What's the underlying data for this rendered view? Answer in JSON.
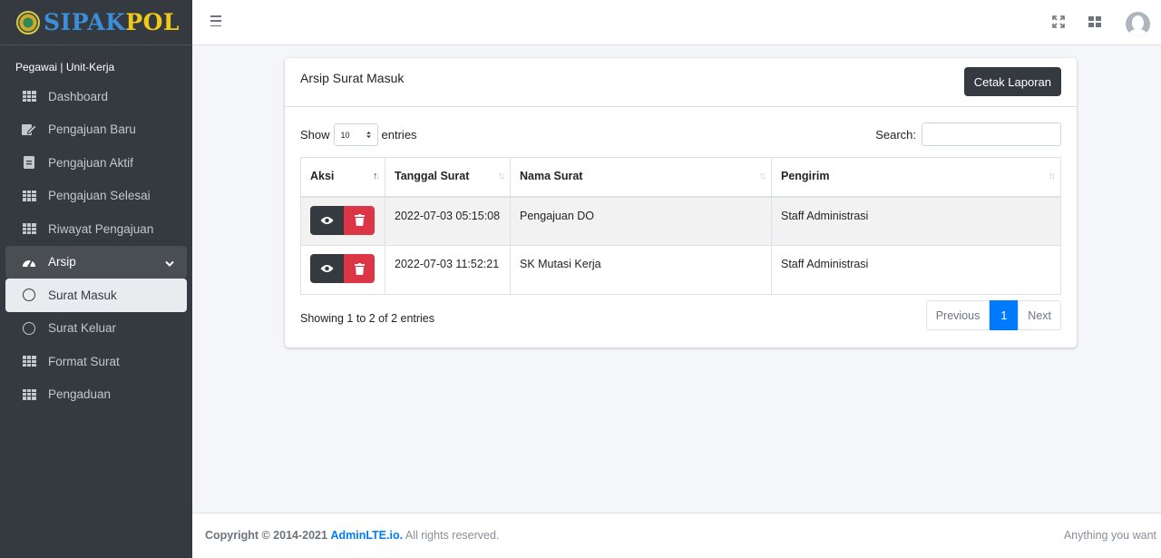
{
  "brand": {
    "part1": "SIPAK",
    "part2": "POL"
  },
  "sidebar": {
    "user_line": "Pegawai | Unit-Kerja",
    "items": [
      {
        "label": "Dashboard",
        "icon": "grid-icon"
      },
      {
        "label": "Pengajuan Baru",
        "icon": "edit-icon"
      },
      {
        "label": "Pengajuan Aktif",
        "icon": "document-icon"
      },
      {
        "label": "Pengajuan Selesai",
        "icon": "grid-icon"
      },
      {
        "label": "Riwayat Pengajuan",
        "icon": "grid-icon"
      },
      {
        "label": "Arsip",
        "icon": "tachometer-icon",
        "expanded": true
      },
      {
        "label": "Surat Masuk",
        "icon": "circle-icon",
        "active": true
      },
      {
        "label": "Surat Keluar",
        "icon": "circle-icon"
      },
      {
        "label": "Format Surat",
        "icon": "grid-icon"
      },
      {
        "label": "Pengaduan",
        "icon": "grid-icon"
      }
    ]
  },
  "card": {
    "title": "Arsip Surat Masuk",
    "print_button": "Cetak Laporan",
    "show_label": "Show",
    "entries_label": "entries",
    "page_size": "10",
    "search_label": "Search:",
    "search_value": ""
  },
  "table": {
    "headers": [
      "Aksi",
      "Tanggal Surat",
      "Nama Surat",
      "Pengirim"
    ],
    "rows": [
      {
        "tanggal": "2022-07-03 05:15:08",
        "nama": "Pengajuan DO",
        "pengirim": "Staff Administrasi"
      },
      {
        "tanggal": "2022-07-03 11:52:21",
        "nama": "SK Mutasi Kerja",
        "pengirim": "Staff Administrasi"
      }
    ]
  },
  "info": "Showing 1 to 2 of 2 entries",
  "pagination": {
    "previous": "Previous",
    "current": "1",
    "next": "Next"
  },
  "footer": {
    "copyright": "Copyright © 2014-2021",
    "link": "AdminLTE.io.",
    "rights": "All rights reserved.",
    "right_text": "Anything you want"
  },
  "colors": {
    "sidebar": "#343a40",
    "primary": "#007bff",
    "danger": "#dc3545",
    "brand_blue": "#3d8ed8",
    "brand_yellow": "#f2c818"
  }
}
